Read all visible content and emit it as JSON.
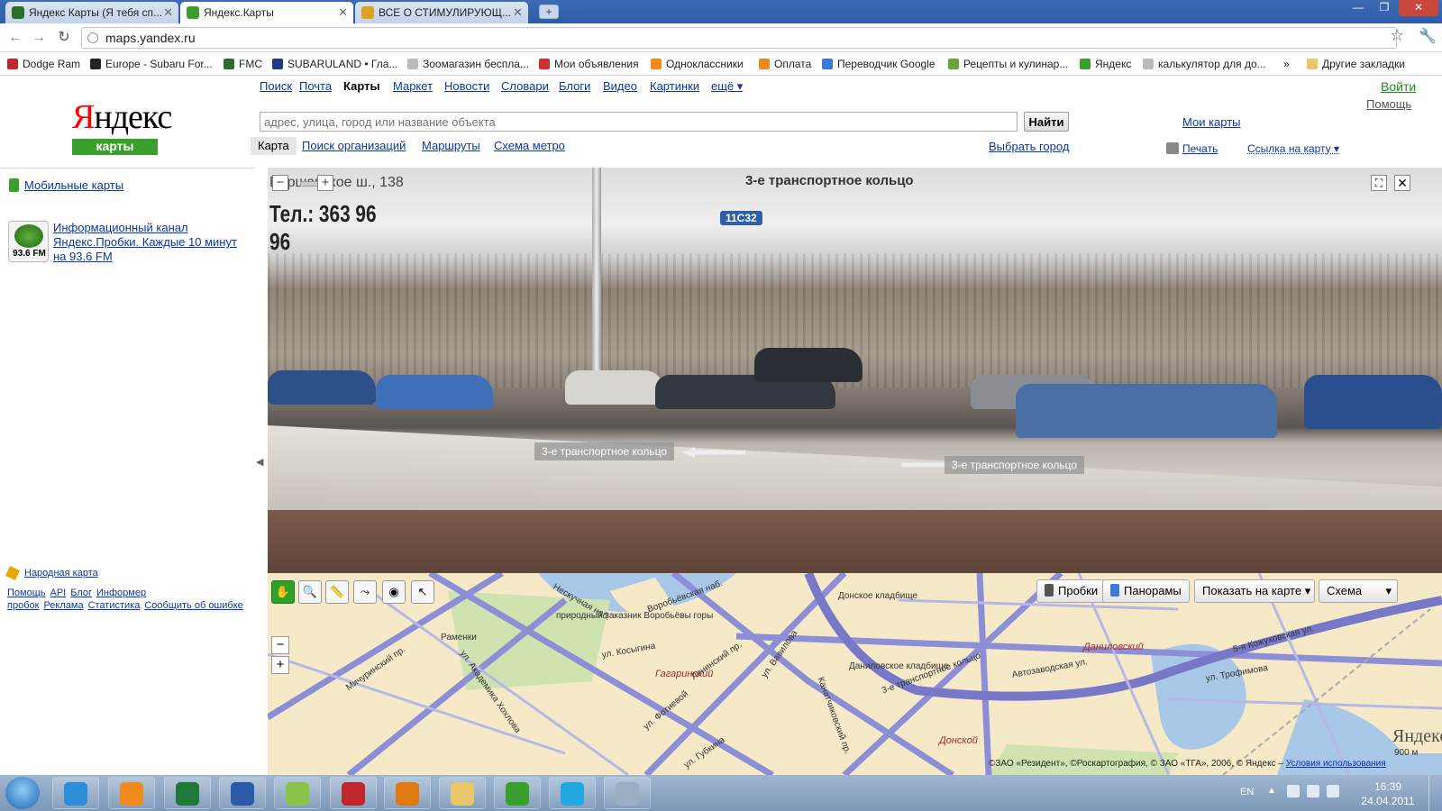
{
  "browser": {
    "tabs": [
      {
        "label": "Яндекс Карты (Я тебя сп...",
        "color": "#2b6f2b"
      },
      {
        "label": "Яндекс.Карты",
        "color": "#3aa02d"
      },
      {
        "label": "ВСЕ О СТИМУЛИРУЮЩ...",
        "color": "#e0a020"
      }
    ],
    "url": "maps.yandex.ru",
    "bookmarks": [
      {
        "label": "Dodge Ram",
        "color": "#c0272d"
      },
      {
        "label": "Europe - Subaru For...",
        "color": "#222222"
      },
      {
        "label": "FMC",
        "color": "#2b6f2b"
      },
      {
        "label": "SUBARULAND • Гла...",
        "color": "#1d3b86"
      },
      {
        "label": "Зоомагазин бесплa...",
        "color": "#bbbbbb"
      },
      {
        "label": "Мои объявления",
        "color": "#d03030"
      },
      {
        "label": "Одноклассники",
        "color": "#f08a1c"
      },
      {
        "label": "Оплата",
        "color": "#f08a1c"
      },
      {
        "label": "Переводчик Google",
        "color": "#3a7ad8"
      },
      {
        "label": "Рецепты и кулинар...",
        "color": "#6aa43a"
      },
      {
        "label": "Яндекс",
        "color": "#3aa02d"
      },
      {
        "label": "калькулятор для до...",
        "color": "#bbbbbb"
      }
    ],
    "bookmarks_more": "»",
    "other_bookmarks": "Другие закладки"
  },
  "yandex": {
    "logo_first": "Я",
    "logo_rest": "ндекс",
    "logo_sub": "карты",
    "services": [
      "Поиск",
      "Почта",
      "Карты",
      "Маркет",
      "Новости",
      "Словари",
      "Блоги",
      "Видео",
      "Картинки",
      "ещё ▾"
    ],
    "login": "Войти",
    "help": "Помощь",
    "search_placeholder": "адрес, улица, город или название объекта",
    "search_button": "Найти",
    "my_maps": "Мои карты",
    "subtabs": [
      "Карта",
      "Поиск организаций",
      "Маршруты",
      "Схема метро"
    ],
    "choose_city": "Выбрать город",
    "print": "Печать",
    "link_to_map": "Ссылка на карту ▾"
  },
  "left": {
    "mobile_maps": "Мобильные карты",
    "radio_freq": "93.6 FM",
    "radio_text": "Информационный канал Яндекс.Пробки. Каждые 10 минут на 93.6 FM",
    "narod": "Народная карта",
    "footer_links": [
      "Помощь",
      "API",
      "Блог",
      "Информер пробок",
      "Реклама",
      "Статистика",
      "Сообщить об ошибке"
    ]
  },
  "panorama": {
    "title": "3-е транспортное кольцо",
    "tag": "11С32",
    "sign_address": "Варшавское ш., 138",
    "sign_phone": "Тел.: 363 96 96",
    "road_label_left": "3-е транспортное кольцо",
    "road_label_right": "3-е транспортное кольцо"
  },
  "map": {
    "controls": {
      "traffic": "Пробки",
      "panoramas": "Панорамы",
      "show_on_map": "Показать на карте",
      "scheme": "Схема"
    },
    "labels": [
      "природный заказник Воробьёвы горы",
      "Раменки",
      "ул. Косыгина",
      "ул. Академика Хохлова",
      "Мичуринский пр.",
      "Воробьёвская наб.",
      "Гагаринский",
      "Ленинский пр.",
      "ул. Вавилова",
      "ул. Фотиевой",
      "Канатчиковский пр.",
      "Донское кладбище",
      "Даниловское кладбище",
      "3-е транспортное кольцо",
      "Автозаводская ул.",
      "Даниловский",
      "5-я Кожуховская ул.",
      "ул. Трофимова",
      "Донской",
      "ул. Губкина",
      "Нескучная наб."
    ],
    "copyright": "©ЗАО «Резидент», ©Роскартография, © ЗАО «ТГА», 2006, © Яндекс –",
    "terms": "Условия использования",
    "logo": "Яндекс",
    "scale": "900 м",
    "colors": {
      "land": "#f5e9c8",
      "park": "#cfe3b0",
      "water": "#a9c8e8",
      "road_major": "#8d8fd6",
      "road_ring": "#7778c8"
    }
  },
  "taskbar": {
    "apps": [
      {
        "name": "ie",
        "color": "#2c8ed8"
      },
      {
        "name": "media-player",
        "color": "#f08a1c"
      },
      {
        "name": "excel",
        "color": "#1f7a3a"
      },
      {
        "name": "word",
        "color": "#2a5aa8"
      },
      {
        "name": "app-green",
        "color": "#8bc34a"
      },
      {
        "name": "camera",
        "color": "#c0272d"
      },
      {
        "name": "illustrator",
        "color": "#e07a10"
      },
      {
        "name": "explorer",
        "color": "#e8c66a"
      },
      {
        "name": "chrome",
        "color": "#3aa02d"
      },
      {
        "name": "skype",
        "color": "#22a8e0"
      },
      {
        "name": "webcam",
        "color": "#9aaec4"
      }
    ],
    "lang": "EN",
    "time": "16:39",
    "date": "24.04.2011"
  }
}
